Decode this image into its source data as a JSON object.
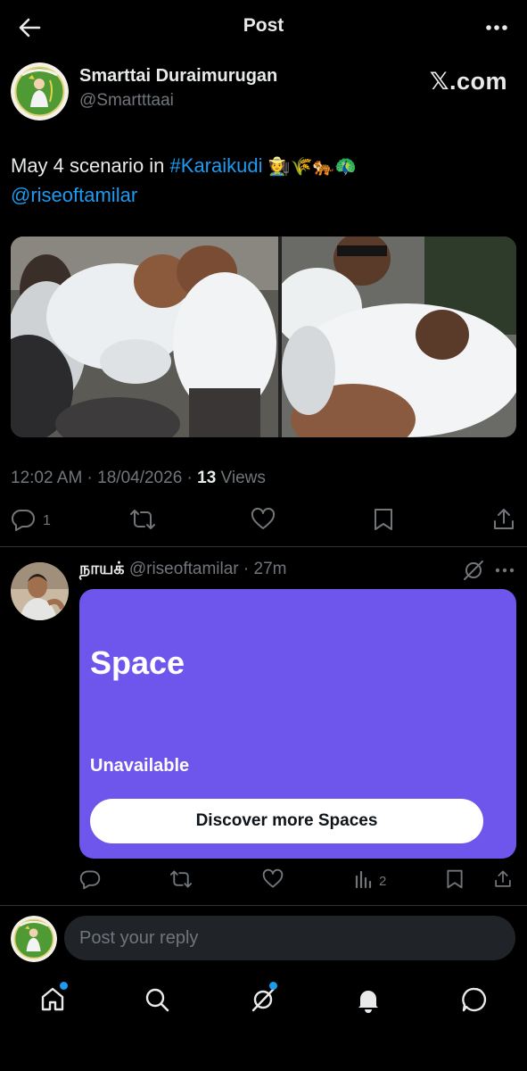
{
  "header": {
    "title": "Post"
  },
  "author": {
    "name": "Smarttai Duraimurugan",
    "handle": "@Smartttaai",
    "source": "𝕏.com"
  },
  "post": {
    "text_prefix": "May 4 scenario in ",
    "hashtag": "#Karaikudi",
    "emojis": "🧑‍🌾🌾🐅🦚",
    "mention": "@riseoftamilar",
    "timestamp": "12:02 AM · 18/04/2026 · ",
    "views_count": "13",
    "views_label": " Views",
    "replies_count": "1"
  },
  "reply": {
    "name": "நாயக்",
    "handle": "@riseoftamilar",
    "time": "· 27m",
    "space_card": {
      "title": "Space",
      "status": "Unavailable",
      "button_label": "Discover more Spaces",
      "background": "#6e56ed"
    },
    "views_count": "2"
  },
  "composer": {
    "placeholder": "Post your reply"
  },
  "colors": {
    "accent": "#1d9bf0",
    "muted": "#71767b",
    "text": "#e7e9ea",
    "background": "#000000"
  }
}
